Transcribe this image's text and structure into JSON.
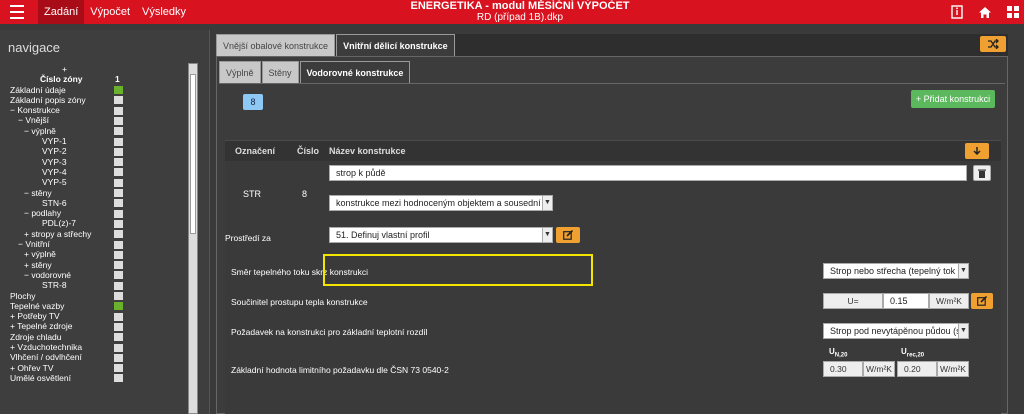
{
  "topbar": {
    "menu": [
      "Zadání",
      "Výpočet",
      "Výsledky"
    ],
    "app_title": "ENERGETIKA - modul MĚSÍČNÍ VÝPOČET",
    "file": "RD (případ 1B).dkp",
    "icons": [
      "menu-icon",
      "info-book-icon",
      "home-icon",
      "grid-icon"
    ]
  },
  "nav": {
    "title": "navigace",
    "zone_header": "Číslo zóny",
    "zone_number": "1",
    "items": [
      {
        "label": "+",
        "indent": 0,
        "box": "none"
      },
      {
        "label": "Základní údaje",
        "indent": 0,
        "box": "green"
      },
      {
        "label": "Základní popis zóny",
        "indent": 0,
        "box": "grey"
      },
      {
        "label": "−  Konstrukce",
        "indent": 0,
        "box": "grey"
      },
      {
        "label": "−  Vnější",
        "indent": 1,
        "box": "grey"
      },
      {
        "label": "−  výplně",
        "indent": 2,
        "box": "grey"
      },
      {
        "label": "VYP-1",
        "indent": 4,
        "box": "grey"
      },
      {
        "label": "VYP-2",
        "indent": 4,
        "box": "grey"
      },
      {
        "label": "VYP-3",
        "indent": 4,
        "box": "grey"
      },
      {
        "label": "VYP-4",
        "indent": 4,
        "box": "grey"
      },
      {
        "label": "VYP-5",
        "indent": 4,
        "box": "grey"
      },
      {
        "label": "−  stěny",
        "indent": 2,
        "box": "grey"
      },
      {
        "label": "STN-6",
        "indent": 4,
        "box": "grey"
      },
      {
        "label": "−  podlahy",
        "indent": 2,
        "box": "grey"
      },
      {
        "label": "PDL(z)-7",
        "indent": 4,
        "box": "grey"
      },
      {
        "label": "+  stropy a střechy",
        "indent": 2,
        "box": "grey"
      },
      {
        "label": "−  Vnitřní",
        "indent": 1,
        "box": "grey"
      },
      {
        "label": "+  výplně",
        "indent": 2,
        "box": "grey"
      },
      {
        "label": "+  stěny",
        "indent": 2,
        "box": "grey"
      },
      {
        "label": "−  vodorovné",
        "indent": 2,
        "box": "grey"
      },
      {
        "label": "STR-8",
        "indent": 4,
        "box": "grey"
      },
      {
        "label": "Plochy",
        "indent": 0,
        "box": "grey"
      },
      {
        "label": "Tepelné vazby",
        "indent": 0,
        "box": "green"
      },
      {
        "label": "+  Potřeby TV",
        "indent": 0,
        "box": "grey"
      },
      {
        "label": "+  Tepelné zdroje",
        "indent": 0,
        "box": "grey"
      },
      {
        "label": "Zdroje chladu",
        "indent": 0,
        "box": "grey"
      },
      {
        "label": "+  Vzduchotechnika",
        "indent": 0,
        "box": "grey"
      },
      {
        "label": "Vlhčení / odvlhčení",
        "indent": 0,
        "box": "grey"
      },
      {
        "label": "+  Ohřev TV",
        "indent": 0,
        "box": "grey"
      },
      {
        "label": "Umělé osvětlení",
        "indent": 0,
        "box": "grey"
      }
    ]
  },
  "tabs_top": [
    "Vnější obalové konstrukce",
    "Vnitřní dělicí konstrukce"
  ],
  "tabs_sub": [
    "Výplně",
    "Stěny",
    "Vodorovné konstrukce"
  ],
  "chip": "8",
  "add_button": "+ Přidat konstrukci",
  "table": {
    "headers": [
      "Označení",
      "Číslo",
      "Název konstrukce"
    ],
    "row": {
      "code": "STR",
      "number": "8",
      "name": "strop k půdě",
      "type": "konstrukce mezi hodnoceným objektem a sousední bu"
    },
    "prostredi_label": "Prostředí za",
    "prostredi_value": "51. Definuj vlastní profil",
    "smer_label": "Směr tepelného toku skrz konstrukci",
    "smer_value": "Strop nebo střecha (tepelný tok n",
    "soucinitel_label": "Součinitel prostupu tepla konstrukce",
    "u_symbol": "U=",
    "u_value": "0.15",
    "u_unit": "W/m²K",
    "pozadavek_label": "Požadavek na konstrukci pro základní teplotní rozdíl",
    "pozadavek_value": "Strop pod nevytápěnou půdou (s",
    "zakladni_label": "Základní hodnota limitního požadavku dle ČSN 73 0540-2",
    "un20_label": "U",
    "un20_sub": "N,20",
    "un20_value": "0.30",
    "urec20_label": "U",
    "urec20_sub": "rec,20",
    "urec20_value": "0.20",
    "unit": "W/m²K"
  },
  "colors": {
    "topbar": "#d8121f",
    "accent_orange": "#f0a030",
    "green": "#5cb85c",
    "highlight": "#f4e500"
  }
}
